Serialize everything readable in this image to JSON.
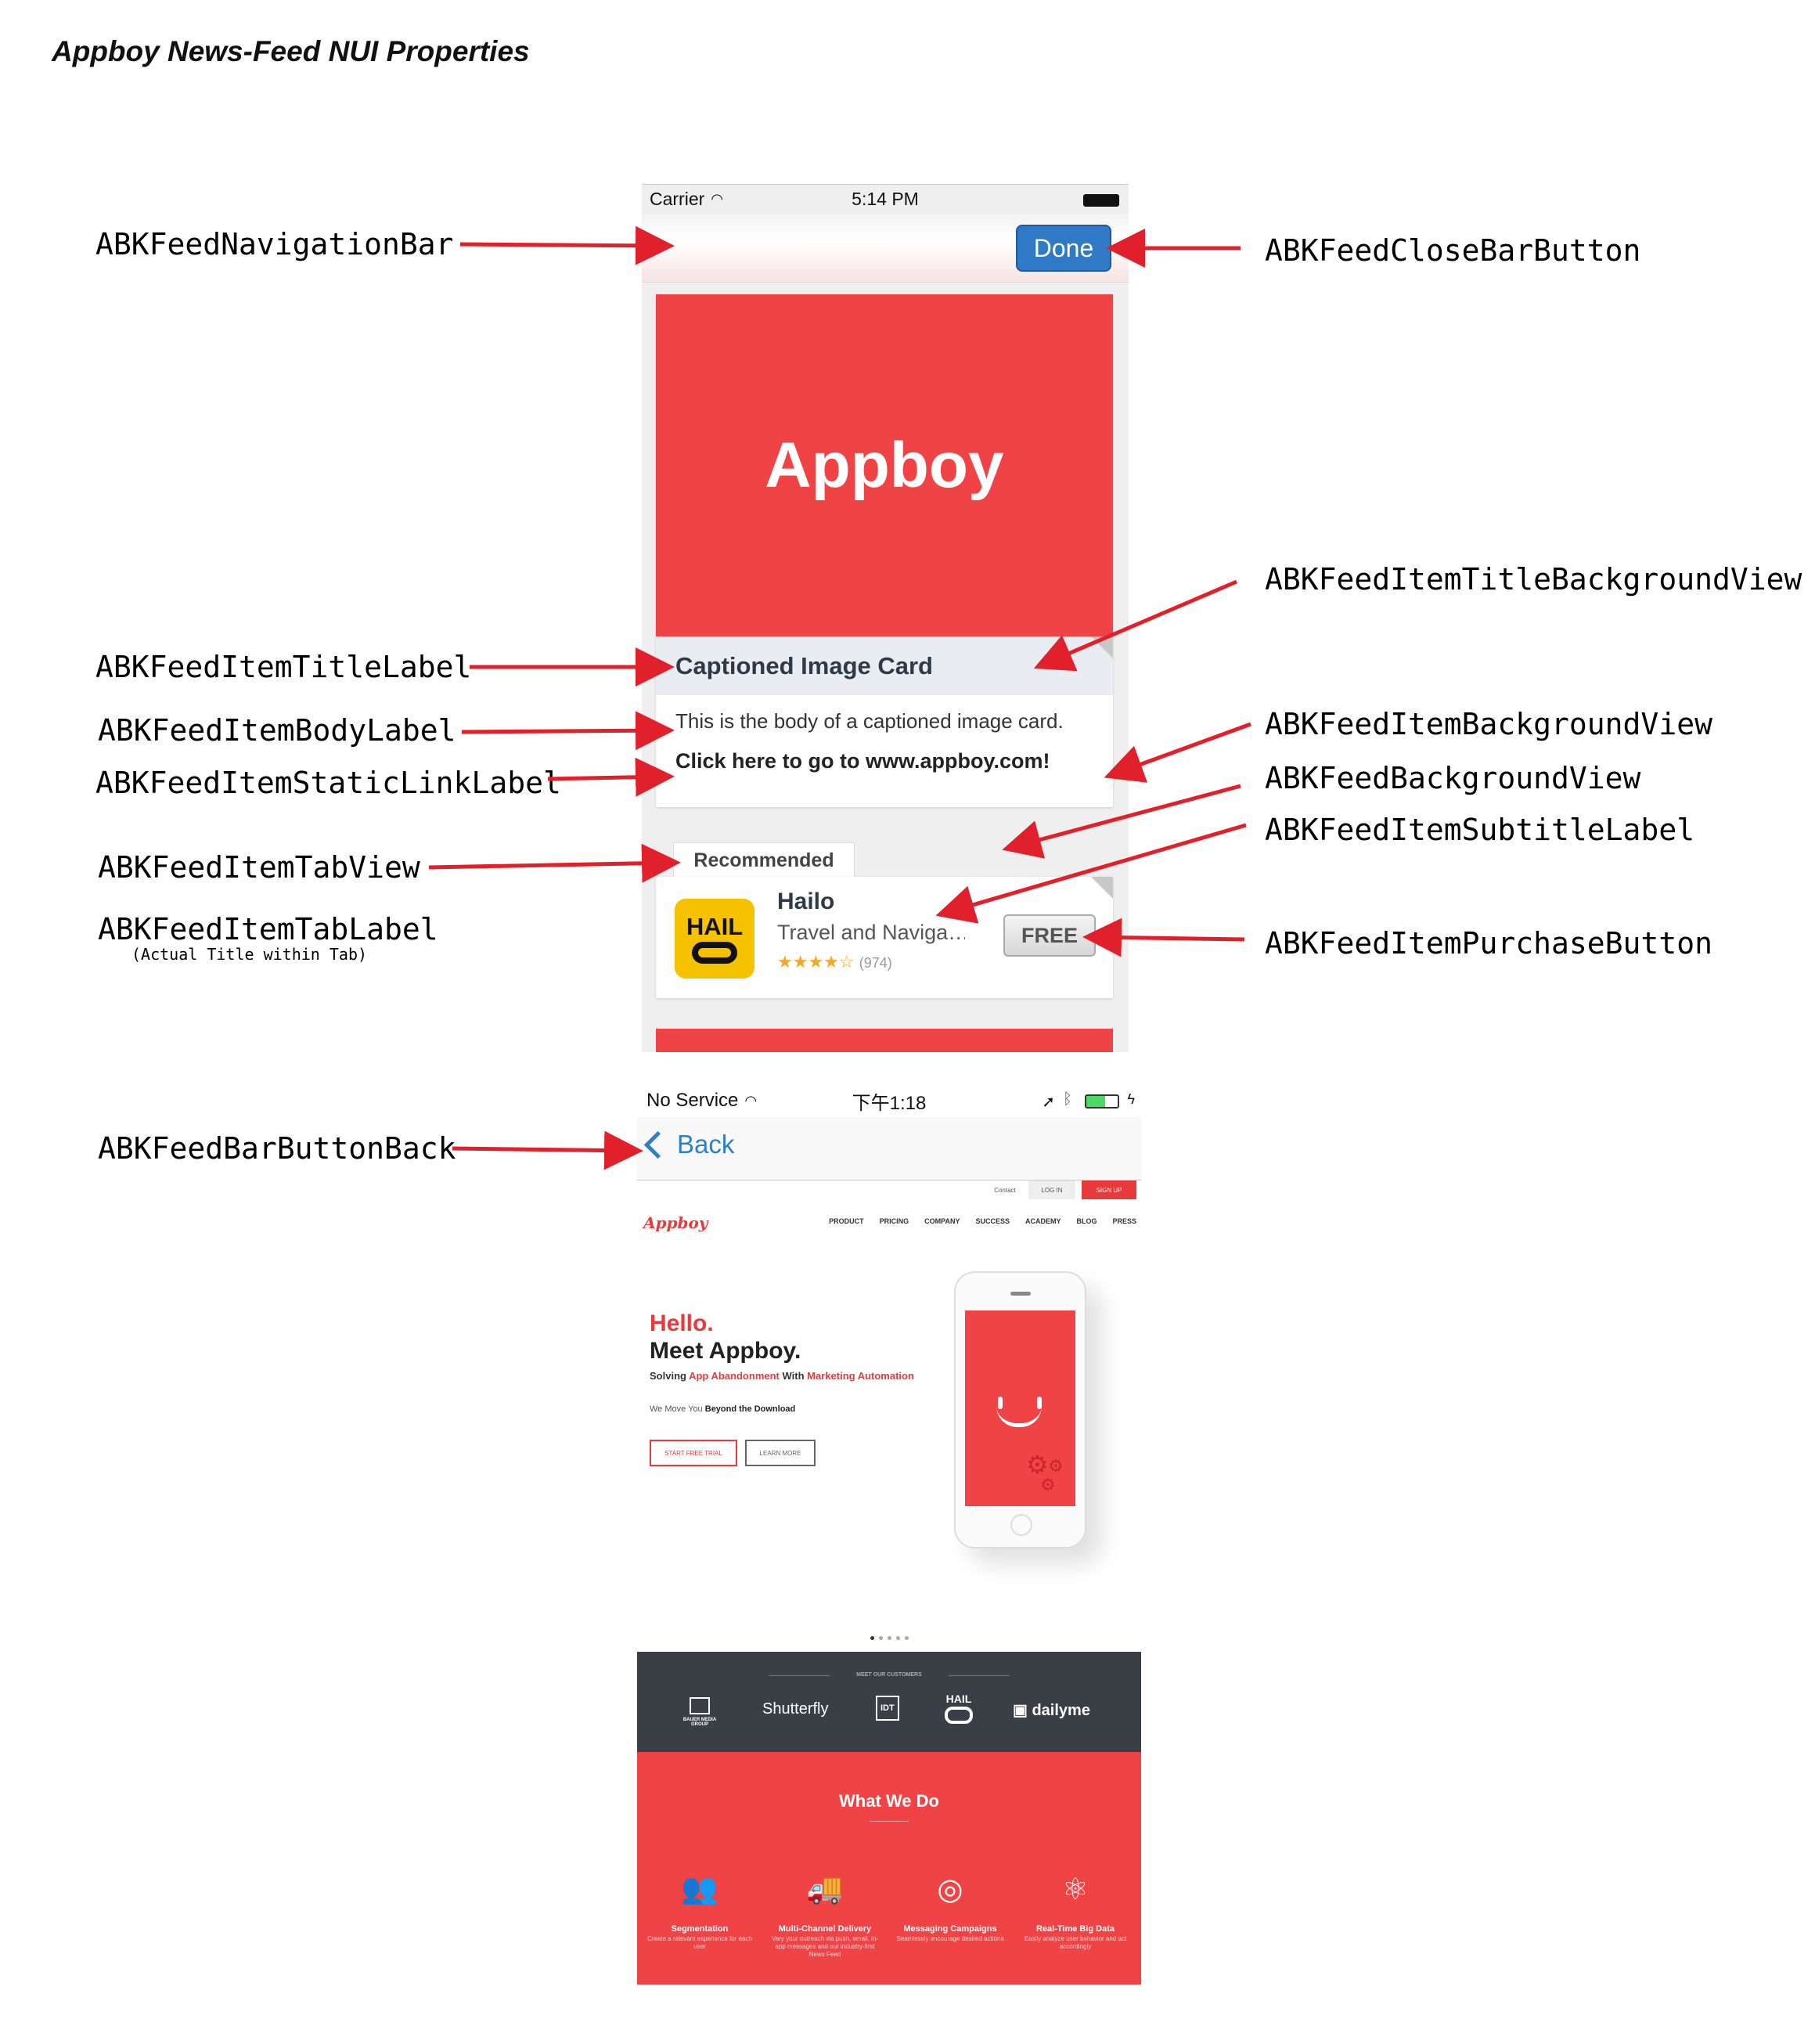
{
  "page_title": "Appboy News-Feed NUI Properties",
  "callouts": {
    "navigation_bar": "ABKFeedNavigationBar",
    "close_bar_button": "ABKFeedCloseBarButton",
    "item_title_background_view": "ABKFeedItemTitleBackgroundView",
    "item_title_label": "ABKFeedItemTitleLabel",
    "item_body_label": "ABKFeedItemBodyLabel",
    "item_static_link_label": "ABKFeedItemStaticLinkLabel",
    "item_background_view": "ABKFeedItemBackgroundView",
    "background_view": "ABKFeedBackgroundView",
    "item_subtitle_label": "ABKFeedItemSubtitleLabel",
    "item_tab_view": "ABKFeedItemTabView",
    "item_tab_label": "ABKFeedItemTabLabel",
    "item_tab_label_note": "(Actual Title within Tab)",
    "item_purchase_button": "ABKFeedItemPurchaseButton",
    "bar_button_back": "ABKFeedBarButtonBack"
  },
  "phone1": {
    "status": {
      "carrier": "Carrier",
      "time": "5:14 PM"
    },
    "nav": {
      "done_label": "Done"
    },
    "captioned_card": {
      "image_text": "Appboy",
      "title": "Captioned Image Card",
      "body": "This is the body of a captioned image card.",
      "link": "Click here to go to www.appboy.com!"
    },
    "tab_label": "Recommended",
    "app_card": {
      "icon_text": "HAIL",
      "name": "Hailo",
      "subtitle": "Travel and Naviga…",
      "stars": "★★★★☆",
      "rating_count": "(974)",
      "price_label": "FREE"
    }
  },
  "phone2": {
    "status": {
      "carrier": "No Service",
      "time": "下午1:18"
    },
    "nav": {
      "back_label": "Back"
    },
    "web": {
      "top_links": {
        "contact": "Contact",
        "login": "LOG IN",
        "signup": "SIGN UP"
      },
      "logo": "Appboy",
      "menu": [
        "PRODUCT",
        "PRICING",
        "COMPANY",
        "SUCCESS",
        "ACADEMY",
        "BLOG",
        "PRESS"
      ],
      "hero": {
        "hello": "Hello.",
        "meet": "Meet Appboy.",
        "solving_prefix": "Solving",
        "solving_red1": "App Abandonment",
        "solving_mid": "With",
        "solving_red2": "Marketing Automation",
        "we_move_prefix": "We Move You",
        "we_move_bold": "Beyond the Download",
        "trial_button": "START FREE TRIAL",
        "learn_button": "LEARN MORE"
      },
      "customers_title": "MEET OUR CUSTOMERS",
      "customers": [
        "BAUER MEDIA GROUP",
        "Shutterfly",
        "IDT",
        "HAIL",
        "dailyme"
      ],
      "what_we_do": {
        "title": "What We Do",
        "features": [
          {
            "name": "Segmentation",
            "desc": "Create a relevant experience for each user",
            "icon": "people-icon"
          },
          {
            "name": "Multi-Channel Delivery",
            "desc": "Vary your outreach via push, email, in-app messages and our industry-first News Feed",
            "icon": "delivery-icon"
          },
          {
            "name": "Messaging Campaigns",
            "desc": "Seamlessly encourage desired actions",
            "icon": "lifebuoy-icon"
          },
          {
            "name": "Real-Time Big Data",
            "desc": "Easily analyze user behavior and act accordingly",
            "icon": "network-icon"
          }
        ]
      }
    }
  },
  "colors": {
    "brand_red": "#f04345",
    "ios_blue": "#2f79c7",
    "arrow_red": "#e0202a",
    "hail_yellow": "#f6c200"
  }
}
